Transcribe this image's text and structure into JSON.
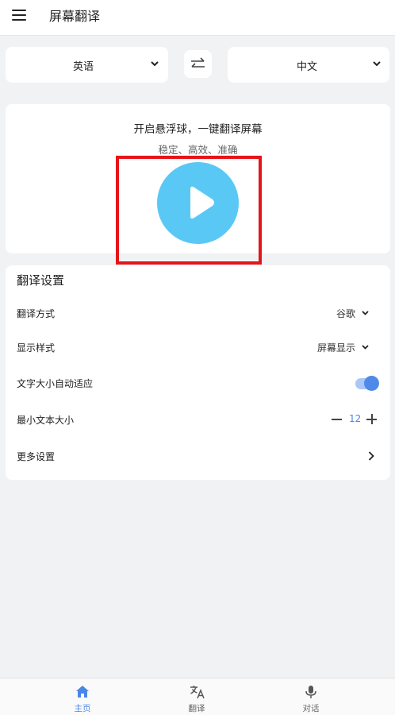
{
  "appbar": {
    "title": "屏幕翻译",
    "menu_icon": "menu-icon"
  },
  "languages": {
    "source": "英语",
    "target": "中文",
    "swap_icon": "swap-arrows-icon"
  },
  "float_card": {
    "title": "开启悬浮球，一键翻译屏幕",
    "subtitle": "稳定、高效、准确",
    "play_icon": "play-icon"
  },
  "settings": {
    "title": "翻译设置",
    "translate_method": {
      "label": "翻译方式",
      "value": "谷歌"
    },
    "display_style": {
      "label": "显示样式",
      "value": "屏幕显示"
    },
    "auto_font": {
      "label": "文字大小自动适应",
      "enabled": true
    },
    "min_text_size": {
      "label": "最小文本大小",
      "value": "12"
    },
    "more": {
      "label": "更多设置"
    }
  },
  "nav": {
    "items": [
      {
        "label": "主页",
        "icon": "home-icon",
        "active": true
      },
      {
        "label": "翻译",
        "icon": "translate-icon",
        "active": false
      },
      {
        "label": "对话",
        "icon": "microphone-icon",
        "active": false
      }
    ]
  },
  "colors": {
    "accent": "#4a86e8",
    "play": "#5ac8f5",
    "highlight": "#e5141a",
    "background": "#f1f2f4"
  }
}
